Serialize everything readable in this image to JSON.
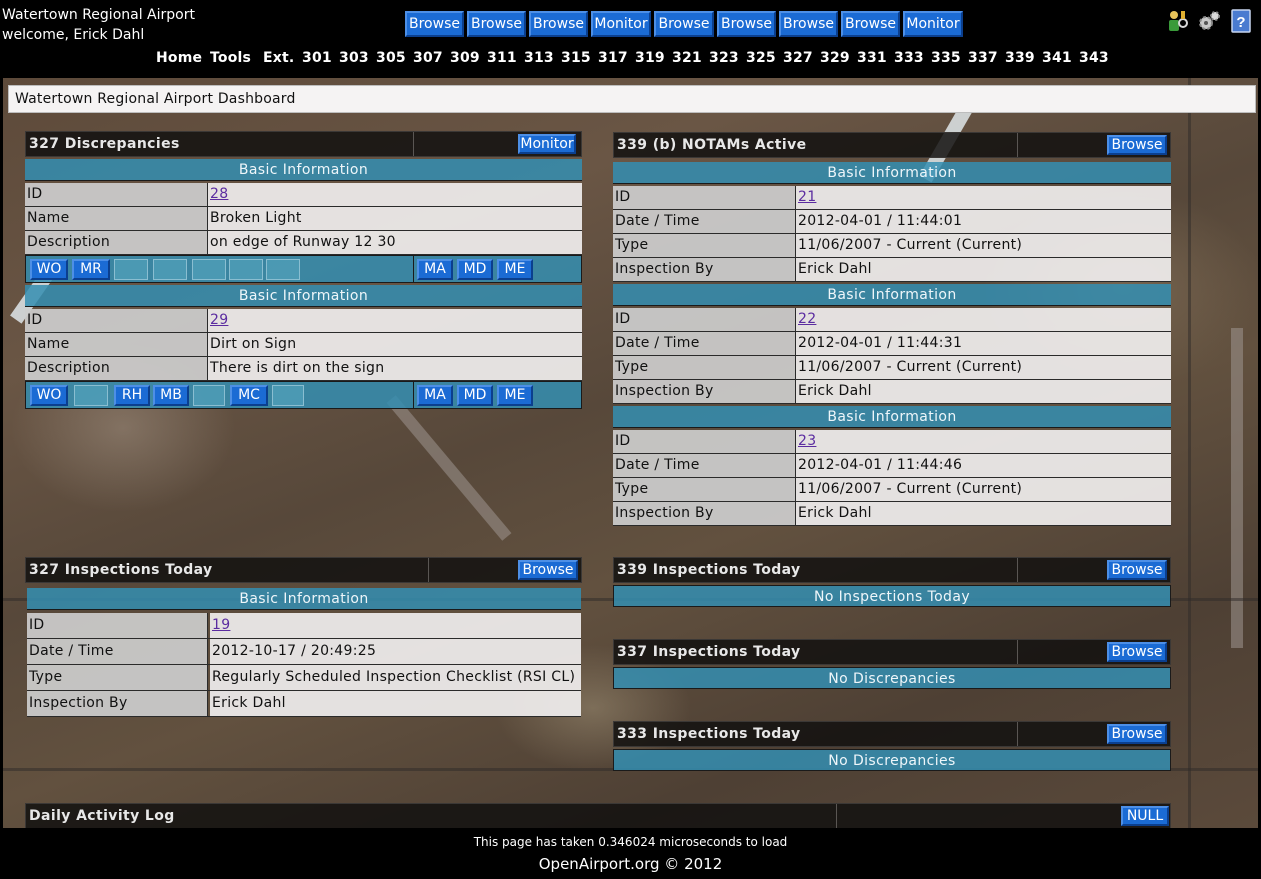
{
  "header": {
    "title": "Watertown Regional Airport",
    "welcome": "welcome, Erick Dahl",
    "buttons": [
      "Browse",
      "Browse",
      "Browse",
      "Monitor",
      "Browse",
      "Browse",
      "Browse",
      "Browse",
      "Monitor"
    ],
    "icons": [
      "user-settings-icon",
      "gears-icon",
      "help-icon"
    ],
    "nav": [
      "Home",
      "Tools",
      "Ext.",
      "301",
      "303",
      "305",
      "307",
      "309",
      "311",
      "313",
      "315",
      "317",
      "319",
      "321",
      "323",
      "325",
      "327",
      "329",
      "331",
      "333",
      "335",
      "337",
      "339",
      "341",
      "343"
    ]
  },
  "dashboard_title": "Watertown Regional Airport Dashboard",
  "discrepancies": {
    "title": "327 Discrepancies",
    "button": "Monitor",
    "records": [
      {
        "band": "Basic Information",
        "rows": [
          {
            "label": "ID",
            "value": "28",
            "link": true
          },
          {
            "label": "Name",
            "value": "Broken Light"
          },
          {
            "label": "Description",
            "value": "on edge of Runway 12 30"
          }
        ],
        "actions_left": [
          "WO",
          "MR",
          "",
          "",
          "",
          "",
          ""
        ],
        "actions_right": [
          "MA",
          "MD",
          "ME"
        ]
      },
      {
        "band": "Basic Information",
        "rows": [
          {
            "label": "ID",
            "value": "29",
            "link": true
          },
          {
            "label": "Name",
            "value": "Dirt on Sign"
          },
          {
            "label": "Description",
            "value": "There is dirt on the sign"
          }
        ],
        "actions_left": [
          "WO",
          "",
          "RH",
          "MB",
          "",
          "MC",
          ""
        ],
        "actions_right": [
          "MA",
          "MD",
          "ME"
        ]
      }
    ]
  },
  "notams": {
    "title": "339 (b) NOTAMs Active",
    "button": "Browse",
    "records": [
      {
        "band": "Basic Information",
        "rows": [
          {
            "label": "ID",
            "value": "21",
            "link": true
          },
          {
            "label": "Date / Time",
            "value": "2012-04-01 / 11:44:01"
          },
          {
            "label": "Type",
            "value": "11/06/2007 - Current (Current)"
          },
          {
            "label": "Inspection By",
            "value": "Erick Dahl"
          }
        ]
      },
      {
        "band": "Basic Information",
        "rows": [
          {
            "label": "ID",
            "value": "22",
            "link": true
          },
          {
            "label": "Date / Time",
            "value": "2012-04-01 / 11:44:31"
          },
          {
            "label": "Type",
            "value": "11/06/2007 - Current (Current)"
          },
          {
            "label": "Inspection By",
            "value": "Erick Dahl"
          }
        ]
      },
      {
        "band": "Basic Information",
        "rows": [
          {
            "label": "ID",
            "value": "23",
            "link": true
          },
          {
            "label": "Date / Time",
            "value": "2012-04-01 / 11:44:46"
          },
          {
            "label": "Type",
            "value": "11/06/2007 - Current (Current)"
          },
          {
            "label": "Inspection By",
            "value": "Erick Dahl"
          }
        ]
      }
    ]
  },
  "inspections_327": {
    "title": "327 Inspections Today",
    "button": "Browse",
    "band": "Basic Information",
    "rows": [
      {
        "label": "ID",
        "value": "19",
        "link": true
      },
      {
        "label": "Date / Time",
        "value": "2012-10-17 / 20:49:25"
      },
      {
        "label": "Type",
        "value": "Regularly Scheduled Inspection Checklist (RSI CL)"
      },
      {
        "label": "Inspection By",
        "value": "Erick Dahl"
      }
    ]
  },
  "inspections_339": {
    "title": "339 Inspections Today",
    "button": "Browse",
    "notice": "No Inspections Today"
  },
  "inspections_337": {
    "title": "337 Inspections Today",
    "button": "Browse",
    "notice": "No Discrepancies"
  },
  "inspections_333": {
    "title": "333 Inspections Today",
    "button": "Browse",
    "notice": "No Discrepancies"
  },
  "daily_log": {
    "title": "Daily Activity Log",
    "button": "NULL"
  },
  "footer": {
    "load_time": "This page has taken 0.346024 microseconds to load",
    "brand": "OpenAirport.org © 2012"
  },
  "colors": {
    "button": "#1b6bd4",
    "band": "#348eb2",
    "header_bg": "#000000"
  }
}
